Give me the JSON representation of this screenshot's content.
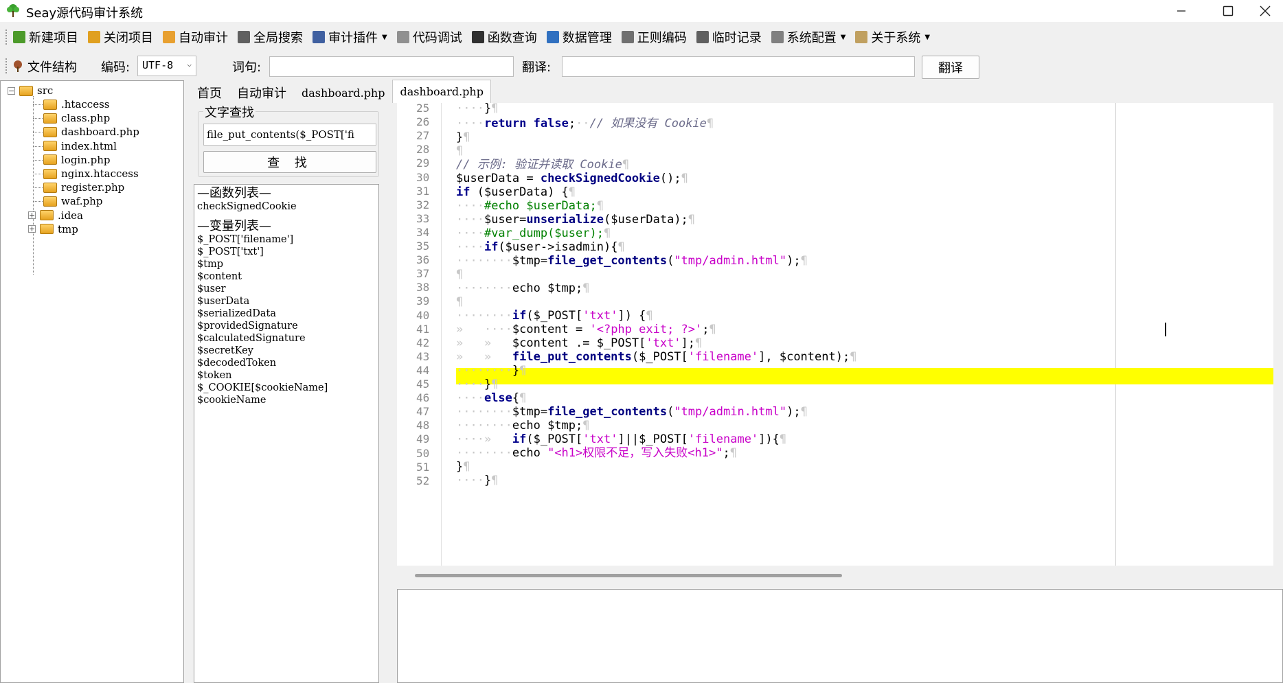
{
  "window": {
    "title": "Seay源代码审计系统"
  },
  "toolbar": {
    "items": [
      {
        "label": "新建项目",
        "icon": "new-project-icon",
        "color": "#4c9a2a"
      },
      {
        "label": "关闭项目",
        "icon": "close-project-icon",
        "color": "#e0a020"
      },
      {
        "label": "自动审计",
        "icon": "auto-audit-icon",
        "color": "#e8a030"
      },
      {
        "label": "全局搜索",
        "icon": "global-search-icon",
        "color": "#606060"
      },
      {
        "label": "审计插件",
        "icon": "plugin-icon",
        "color": "#4060a0",
        "dropdown": true
      },
      {
        "label": "代码调试",
        "icon": "debug-icon",
        "color": "#909090"
      },
      {
        "label": "函数查询",
        "icon": "function-search-icon",
        "color": "#303030"
      },
      {
        "label": "数据管理",
        "icon": "data-manage-icon",
        "color": "#3070c0"
      },
      {
        "label": "正则编码",
        "icon": "regex-icon",
        "color": "#707070"
      },
      {
        "label": "临时记录",
        "icon": "notes-icon",
        "color": "#606060"
      },
      {
        "label": "系统配置",
        "icon": "settings-icon",
        "color": "#808080",
        "dropdown": true
      },
      {
        "label": "关于系统",
        "icon": "about-icon",
        "color": "#c0a060",
        "dropdown": true
      }
    ]
  },
  "bar2": {
    "file_structure_label": "文件结构",
    "encoding_label": "编码:",
    "encoding_value": "UTF-8",
    "word_label": "词句:",
    "word_value": "",
    "translate_label": "翻译:",
    "translate_value": "",
    "translate_button": "翻译"
  },
  "tree": {
    "root": "src",
    "children": [
      ".htaccess",
      "class.php",
      "dashboard.php",
      "index.html",
      "login.php",
      "nginx.htaccess",
      "register.php",
      "waf.php"
    ],
    "folders": [
      ".idea",
      "tmp"
    ]
  },
  "tabs": [
    "首页",
    "自动审计",
    "dashboard.php",
    "dashboard.php"
  ],
  "active_tab": 3,
  "search": {
    "legend": "文字查找",
    "query": "file_put_contents($_POST['fi",
    "button": "查 找"
  },
  "lists": {
    "functions_header": "—函数列表—",
    "functions": [
      "checkSignedCookie"
    ],
    "variables_header": "—变量列表—",
    "variables": [
      "$_POST['filename']",
      "$_POST['txt']",
      "$tmp",
      "$content",
      "$user",
      "$userData",
      "$serializedData",
      "$providedSignature",
      "$calculatedSignature",
      "$secretKey",
      "$decodedToken",
      "$token",
      "$_COOKIE[$cookieName]",
      "$cookieName"
    ]
  },
  "editor": {
    "line_numbers": [
      "25",
      "26",
      "27",
      "28",
      "29",
      "30",
      "31",
      "32",
      "33",
      "34",
      "35",
      "36",
      "37",
      "38",
      "39",
      "40",
      "41",
      "42",
      "43",
      "44",
      "45",
      "46",
      "47",
      "48",
      "49",
      "50",
      "51",
      "52"
    ],
    "highlighted_line": "41",
    "highlight_color": "#ffff00",
    "comment_26": "// 如果没有 Cookie",
    "comment_29": "// 示例: 验证并读取 Cookie",
    "str_admin": "\"tmp/admin.html\"",
    "str_txt": "'txt'",
    "str_filename": "'filename'",
    "str_exit": "'<?php exit; ?>'",
    "str_h1": "\"<h1>权限不足，写入失败<h1>\""
  }
}
